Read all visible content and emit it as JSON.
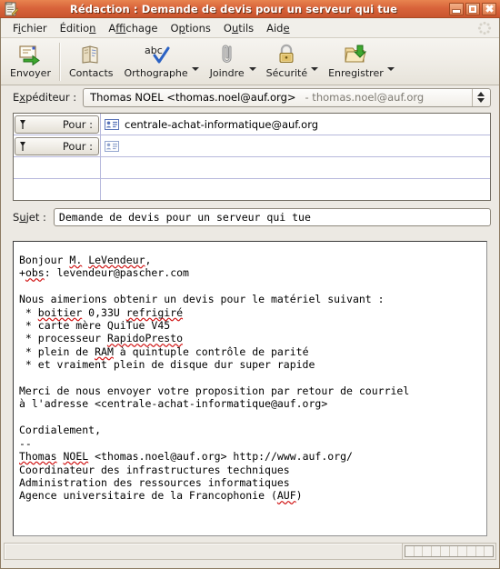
{
  "window": {
    "title": "Rédaction : Demande de devis pour un serveur qui tue",
    "icon": "compose-window-icon",
    "buttons": {
      "minimize": "minimize-button",
      "maximize": "maximize-button",
      "close": "close-button"
    }
  },
  "menubar": {
    "items": [
      {
        "label": "Fichier",
        "pre": "F",
        "mnemonic": "i",
        "post": "chier"
      },
      {
        "label": "Édition",
        "pre": "Éditio",
        "mnemonic": "n",
        "post": ""
      },
      {
        "label": "Affichage",
        "pre": "A",
        "mnemonic": "f",
        "post": "fichage"
      },
      {
        "label": "Options",
        "pre": "O",
        "mnemonic": "p",
        "post": "tions"
      },
      {
        "label": "Outils",
        "pre": "O",
        "mnemonic": "u",
        "post": "tils"
      },
      {
        "label": "Aide",
        "pre": "Aid",
        "mnemonic": "e",
        "post": ""
      }
    ],
    "throbber": "throbber-icon"
  },
  "toolbar": {
    "items": [
      {
        "label": "Envoyer",
        "icon": "send-mail-icon",
        "has_menu": false
      },
      {
        "label": "Contacts",
        "icon": "address-book-icon",
        "has_menu": false
      },
      {
        "label": "Orthographe",
        "icon": "spellcheck-icon",
        "has_menu": true
      },
      {
        "label": "Joindre",
        "icon": "paperclip-icon",
        "has_menu": true
      },
      {
        "label": "Sécurité",
        "icon": "padlock-icon",
        "has_menu": true
      },
      {
        "label": "Enregistrer",
        "icon": "save-folder-icon",
        "has_menu": true
      }
    ]
  },
  "headers": {
    "from_label": "Expéditeur :",
    "from_label_pre": "E",
    "from_label_mnemonic": "x",
    "from_label_post": "péditeur :",
    "from_value": "Thomas NOEL <thomas.noel@auf.org>",
    "from_identity": "- thomas.noel@auf.org",
    "recipients": [
      {
        "type": "Pour :",
        "address": "centrale-achat-informatique@auf.org",
        "has_card_icon": true
      },
      {
        "type": "Pour :",
        "address": "",
        "has_card_icon": true
      }
    ],
    "empty_rows": 2,
    "subject_label": "Sujet :",
    "subject_label_pre": "S",
    "subject_label_mnemonic": "u",
    "subject_label_post": "jet :",
    "subject_value": "Demande de devis pour un serveur qui tue",
    "subject_placeholder": ""
  },
  "body": {
    "lines": [
      [
        {
          "t": "Bonjour "
        },
        {
          "t": "M.",
          "sp": true
        },
        {
          "t": " "
        },
        {
          "t": "LeVendeur",
          "sp": true
        },
        {
          "t": ","
        }
      ],
      [
        {
          "t": "+"
        },
        {
          "t": "obs",
          "sp": true
        },
        {
          "t": ": levendeur@pascher.com"
        }
      ],
      [
        {
          "t": ""
        }
      ],
      [
        {
          "t": "Nous aimerions obtenir un devis pour le matériel suivant :"
        }
      ],
      [
        {
          "t": " * "
        },
        {
          "t": "boitier",
          "sp": true
        },
        {
          "t": " 0,33U "
        },
        {
          "t": "refrigiré",
          "sp": true
        }
      ],
      [
        {
          "t": " * carte mère QuiTue V45"
        }
      ],
      [
        {
          "t": " * processeur "
        },
        {
          "t": "RapidoPresto",
          "sp": true
        }
      ],
      [
        {
          "t": " * plein de "
        },
        {
          "t": "RAM",
          "sp": true
        },
        {
          "t": " à quintuple contrôle de parité"
        }
      ],
      [
        {
          "t": " * et vraiment plein de disque dur super rapide"
        }
      ],
      [
        {
          "t": ""
        }
      ],
      [
        {
          "t": "Merci de nous envoyer votre proposition par retour de courriel"
        }
      ],
      [
        {
          "t": "à l'adresse <centrale-achat-informatique@auf.org>"
        }
      ],
      [
        {
          "t": ""
        }
      ],
      [
        {
          "t": "Cordialement,"
        }
      ],
      [
        {
          "t": "--"
        }
      ],
      [
        {
          "t": "Thomas",
          "sp": true
        },
        {
          "t": " "
        },
        {
          "t": "NOEL",
          "sp": true
        },
        {
          "t": " <thomas.noel@auf.org> http://www.auf.org/"
        }
      ],
      [
        {
          "t": "Coordinateur des infrastructures techniques"
        }
      ],
      [
        {
          "t": "Administration des ressources informatiques"
        }
      ],
      [
        {
          "t": "Agence universitaire de la Francophonie ("
        },
        {
          "t": "AUF",
          "sp": true
        },
        {
          "t": ")"
        }
      ]
    ]
  },
  "statusbar": {
    "message": "",
    "meter_cells": 10
  },
  "colors": {
    "titlebar": "#d9643b",
    "titlebar_text": "#ffffff",
    "window_bg": "#ece9e3",
    "field_bg": "#ffffff",
    "spellcheck_underline": "#d01414",
    "grid_line": "#b6b8dc"
  }
}
